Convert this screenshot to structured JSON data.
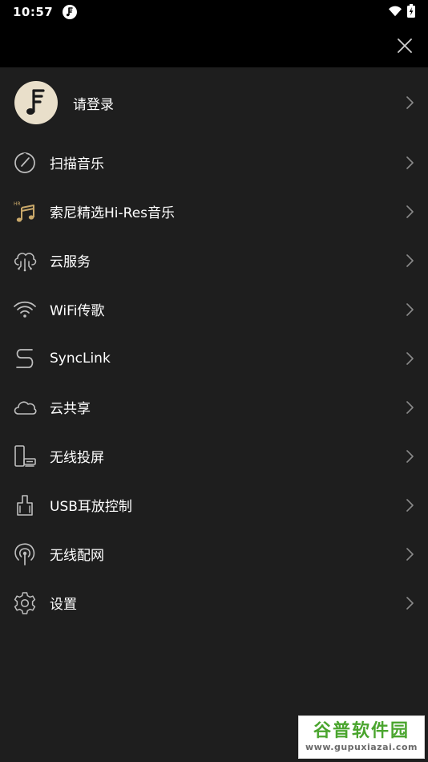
{
  "status_bar": {
    "time": "10:57",
    "icons": [
      "app-notification-icon",
      "wifi-icon",
      "battery-charging-icon"
    ]
  },
  "header": {
    "close_icon": "close-icon"
  },
  "login": {
    "label": "请登录",
    "avatar_icon": "music-note-logo-icon"
  },
  "menu": {
    "items": [
      {
        "label": "扫描音乐",
        "icon": "scan-dial-icon"
      },
      {
        "label": "索尼精选Hi-Res音乐",
        "icon": "hires-note-icon"
      },
      {
        "label": "云服务",
        "icon": "cloud-circuit-icon"
      },
      {
        "label": "WiFi传歌",
        "icon": "wifi-icon"
      },
      {
        "label": "SyncLink",
        "icon": "synclink-s-icon"
      },
      {
        "label": "云共享",
        "icon": "cloud-icon"
      },
      {
        "label": "无线投屏",
        "icon": "cast-device-icon"
      },
      {
        "label": "USB耳放控制",
        "icon": "usb-dac-icon"
      },
      {
        "label": "无线配网",
        "icon": "broadcast-antenna-icon"
      },
      {
        "label": "设置",
        "icon": "gear-icon"
      }
    ]
  },
  "watermark": {
    "title": "谷普软件园",
    "url": "www.gupuxiazai.com"
  },
  "colors": {
    "background": "#1e1e1e",
    "bar": "#000000",
    "icon_stroke": "#bfbfbf",
    "accent_gold": "#c9a86a",
    "avatar_bg": "#e9dfca",
    "chevron": "#8a8a8a",
    "watermark_green": "#4aa52e"
  }
}
